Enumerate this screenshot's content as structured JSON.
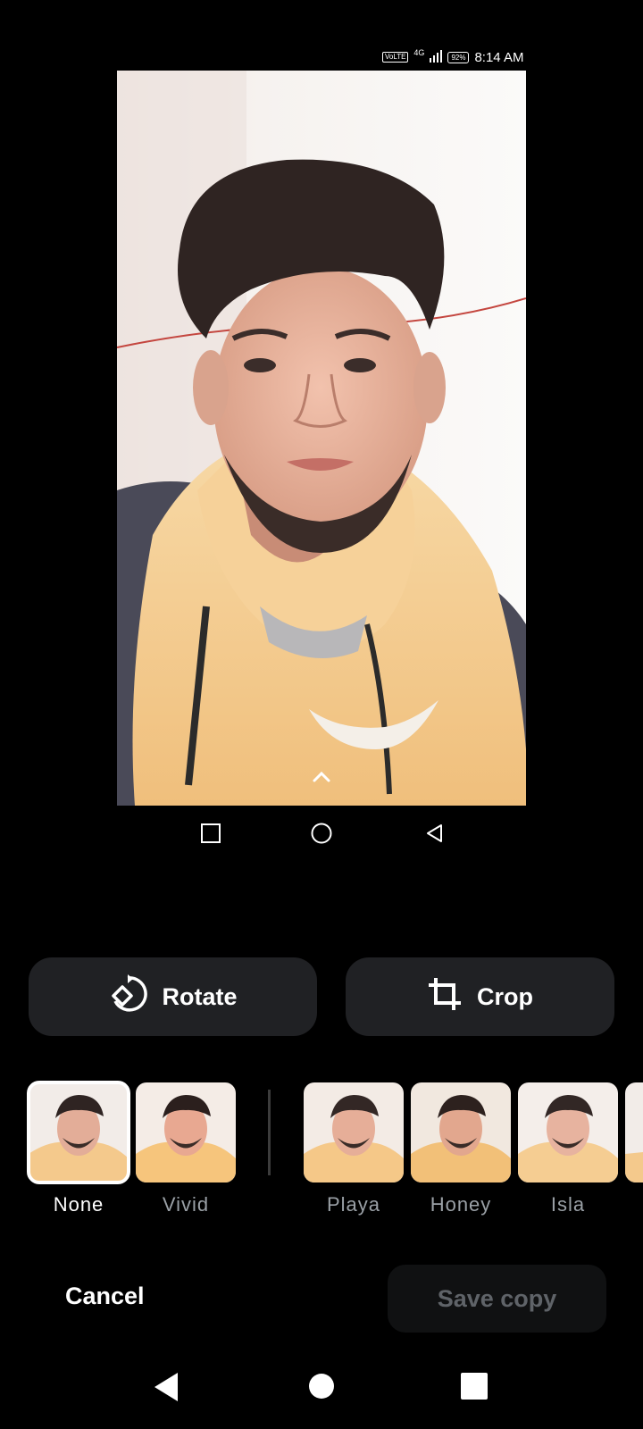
{
  "status_bar": {
    "volte": "VoLTE",
    "network": "4G",
    "battery": "92%",
    "time": "8:14 AM"
  },
  "inner_nav": {
    "recents_icon": "square-outline-icon",
    "home_icon": "circle-outline-icon",
    "back_icon": "triangle-back-outline-icon"
  },
  "tools": {
    "rotate_label": "Rotate",
    "crop_label": "Crop"
  },
  "filters": [
    {
      "label": "None",
      "selected": true
    },
    {
      "label": "Vivid",
      "selected": false
    },
    {
      "label": "Playa",
      "selected": false
    },
    {
      "label": "Honey",
      "selected": false
    },
    {
      "label": "Isla",
      "selected": false
    }
  ],
  "actions": {
    "cancel_label": "Cancel",
    "save_label": "Save copy"
  },
  "colors": {
    "background": "#000000",
    "button_bg": "#202124",
    "hoodie": "#f4c98c"
  }
}
